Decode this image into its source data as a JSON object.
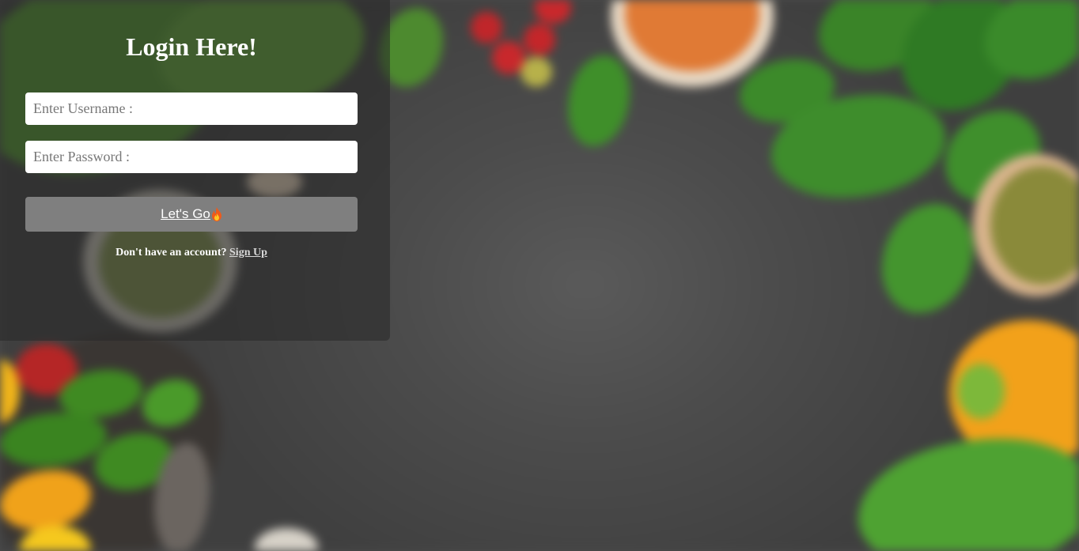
{
  "login": {
    "title": "Login Here!",
    "username_placeholder": "Enter Username :",
    "password_placeholder": "Enter Password :",
    "submit_label": "Let's Go",
    "submit_icon": "flame-icon",
    "signup_prompt": "Don't have an account?",
    "signup_link": "Sign Up"
  },
  "colors": {
    "panel_overlay": "#282828",
    "button_bg": "#7f7f7f",
    "text": "#ffffff",
    "link": "#d8d8d8"
  }
}
